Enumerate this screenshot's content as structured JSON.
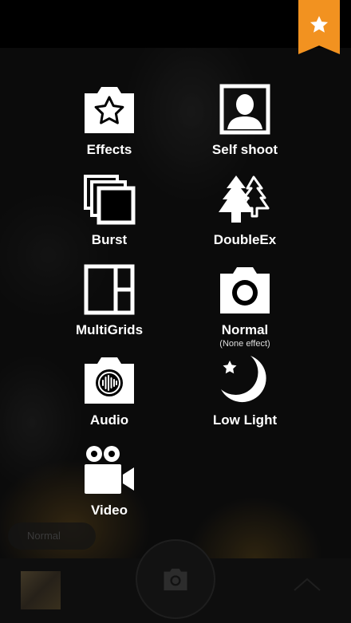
{
  "modes": [
    {
      "id": "effects",
      "label": "Effects",
      "sublabel": "",
      "icon": "star-camera-icon"
    },
    {
      "id": "self-shoot",
      "label": "Self shoot",
      "sublabel": "",
      "icon": "portrait-icon"
    },
    {
      "id": "burst",
      "label": "Burst",
      "sublabel": "",
      "icon": "stacked-frames-icon"
    },
    {
      "id": "doubleex",
      "label": "DoubleEx",
      "sublabel": "",
      "icon": "pine-trees-icon"
    },
    {
      "id": "multigrids",
      "label": "MultiGrids",
      "sublabel": "",
      "icon": "grid-layout-icon"
    },
    {
      "id": "normal",
      "label": "Normal",
      "sublabel": "(None effect)",
      "icon": "camera-icon"
    },
    {
      "id": "audio",
      "label": "Audio",
      "sublabel": "",
      "icon": "audio-camera-icon"
    },
    {
      "id": "low-light",
      "label": "Low Light",
      "sublabel": "",
      "icon": "moon-star-icon"
    },
    {
      "id": "video",
      "label": "Video",
      "sublabel": "",
      "icon": "video-camera-icon"
    }
  ],
  "current_mode_pill": "Normal",
  "colors": {
    "accent": "#f29220",
    "text": "#ffffff"
  }
}
